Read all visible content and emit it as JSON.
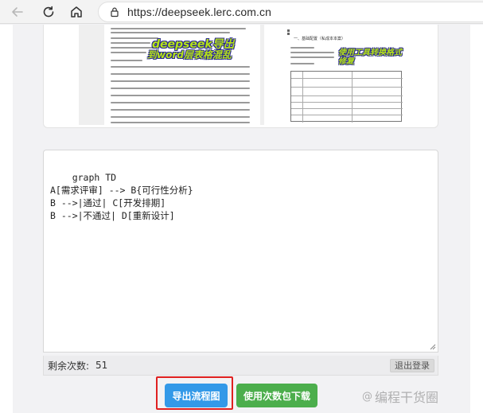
{
  "browser": {
    "url": "https://deepseek.lerc.com.cn"
  },
  "image_card": {
    "left_banner_line1": "deepseek导出",
    "left_banner_line2": "到word层表格混乱",
    "right_heading": "一、基础配置（私成本本案）",
    "right_banner": "使用工具转换格式修复"
  },
  "editor": {
    "code": "graph TD\nA[需求评审] --> B{可行性分析}\nB -->|通过| C[开发排期]\nB -->|不通过| D[重新设计]"
  },
  "status": {
    "remaining_label": "剩余次数:",
    "remaining_count": "51",
    "logout_label": "退出登录"
  },
  "actions": {
    "export_label": "导出流程图",
    "download_label": "使用次数包下载"
  },
  "watermark": {
    "at": "@",
    "text": "编程干货圈"
  },
  "colors": {
    "export_button": "#3399e8",
    "download_button": "#4cae4c",
    "highlight": "#e02020"
  }
}
